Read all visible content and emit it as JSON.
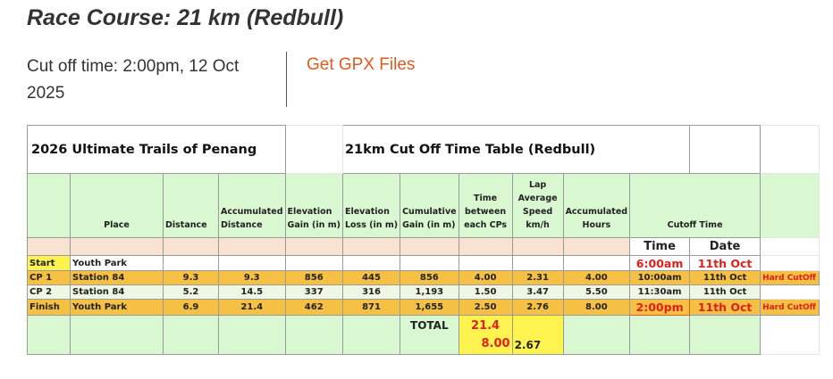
{
  "page": {
    "title": "Race Course: 21 km (Redbull)",
    "cutoff_text": "Cut off time: 2:00pm, 12 Oct 2025",
    "gpx_link": "Get GPX Files"
  },
  "table": {
    "event_title": "2026 Ultimate Trails of Penang",
    "cutoff_title": "21km  Cut Off Time Table (Redbull)",
    "headers": {
      "place": "Place",
      "distance": "Distance",
      "accumulated_distance_1": "Accumulated",
      "accumulated_distance_2": "Distance",
      "elevation_gain_1": "Elevation",
      "elevation_gain_2": "Gain (in m)",
      "elevation_loss_1": "Elevation",
      "elevation_loss_2": "Loss (in m)",
      "cumulative_gain_1": "Cumulative",
      "cumulative_gain_2": "Gain (in m)",
      "time_between_1": "Time",
      "time_between_2": "between",
      "time_between_3": "each CPs",
      "lap_speed_1": "Lap",
      "lap_speed_2": "Average",
      "lap_speed_3": "Speed",
      "lap_speed_4": "km/h",
      "accumulated_hours_1": "Accumulated",
      "accumulated_hours_2": "Hours",
      "cutoff_time": "Cutoff  Time",
      "time": "Time",
      "date": "Date"
    },
    "rows": [
      {
        "cp": "Start",
        "place": "Youth Park",
        "distance": "",
        "acc_distance": "",
        "elev_gain": "",
        "elev_loss": "",
        "cum_gain": "",
        "time_between": "",
        "lap_speed": "",
        "acc_hours": "",
        "time": "6:00am",
        "date": "11th Oct",
        "note": ""
      },
      {
        "cp": "CP 1",
        "place": "Station 84",
        "distance": "9.3",
        "acc_distance": "9.3",
        "elev_gain": "856",
        "elev_loss": "445",
        "cum_gain": "856",
        "time_between": "4.00",
        "lap_speed": "2.31",
        "acc_hours": "4.00",
        "time": "10:00am",
        "date": "11th Oct",
        "note": "Hard CutOff"
      },
      {
        "cp": "CP 2",
        "place": "Station 84",
        "distance": "5.2",
        "acc_distance": "14.5",
        "elev_gain": "337",
        "elev_loss": "316",
        "cum_gain": "1,193",
        "time_between": "1.50",
        "lap_speed": "3.47",
        "acc_hours": "5.50",
        "time": "11:30am",
        "date": "11th Oct",
        "note": ""
      },
      {
        "cp": "Finish",
        "place": "Youth Park",
        "distance": "6.9",
        "acc_distance": "21.4",
        "elev_gain": "462",
        "elev_loss": "871",
        "cum_gain": "1,655",
        "time_between": "2.50",
        "lap_speed": "2.76",
        "acc_hours": "8.00",
        "time": "2:00pm",
        "date": "11th Oct",
        "note": "Hard CutOff"
      }
    ],
    "total": {
      "label": "TOTAL",
      "distance": "21.4",
      "hours": "8.00",
      "speed": "2.67"
    }
  }
}
